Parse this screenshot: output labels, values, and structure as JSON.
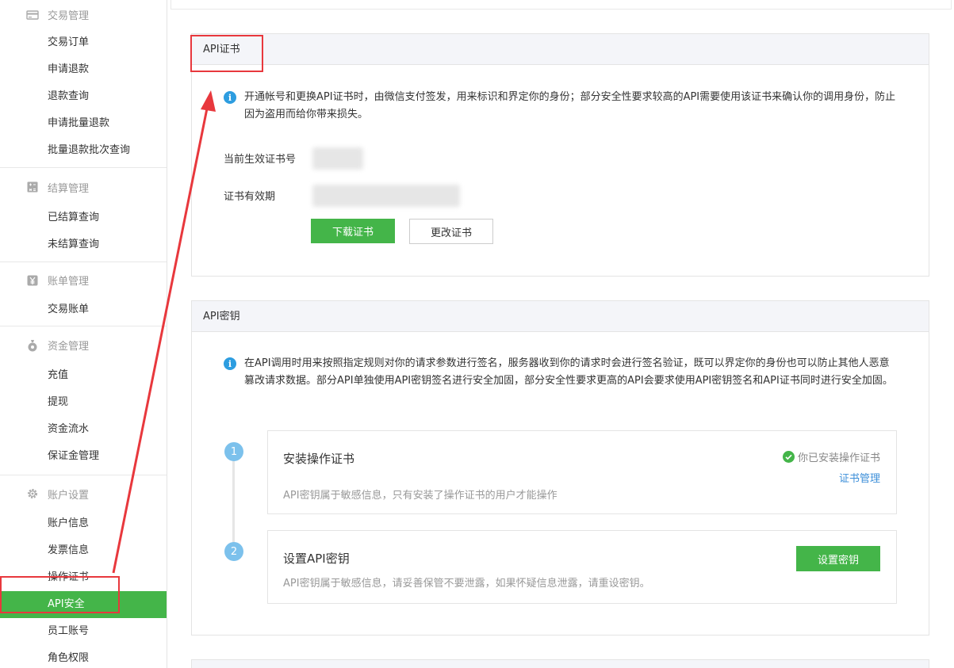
{
  "sidebar": {
    "groups": [
      {
        "title": "交易管理",
        "icon": "card-icon",
        "items": [
          "交易订单",
          "申请退款",
          "退款查询",
          "申请批量退款",
          "批量退款批次查询"
        ]
      },
      {
        "title": "结算管理",
        "icon": "calculator-icon",
        "items": [
          "已结算查询",
          "未结算查询"
        ]
      },
      {
        "title": "账单管理",
        "icon": "yen-icon",
        "items": [
          "交易账单"
        ]
      },
      {
        "title": "资金管理",
        "icon": "money-bag-icon",
        "items": [
          "充值",
          "提现",
          "资金流水",
          "保证金管理"
        ]
      },
      {
        "title": "账户设置",
        "icon": "gear-icon",
        "items": [
          "账户信息",
          "发票信息",
          "操作证书",
          "API安全",
          "员工账号",
          "角色权限"
        ]
      }
    ],
    "active_item": "API安全"
  },
  "cert_panel": {
    "title": "API证书",
    "info": "开通帐号和更换API证书时，由微信支付签发，用来标识和界定你的身份；部分安全性要求较高的API需要使用该证书来确认你的调用身份，防止因为盗用而给你带来损失。",
    "current_cert_label": "当前生效证书号",
    "validity_label": "证书有效期",
    "download_button": "下载证书",
    "change_button": "更改证书"
  },
  "key_panel": {
    "title": "API密钥",
    "info": "在API调用时用来按照指定规则对你的请求参数进行签名，服务器收到你的请求时会进行签名验证，既可以界定你的身份也可以防止其他人恶意篡改请求数据。部分API单独使用API密钥签名进行安全加固，部分安全性要求更高的API会要求使用API密钥签名和API证书同时进行安全加固。",
    "steps": [
      {
        "num": "1",
        "title": "安装操作证书",
        "desc": "API密钥属于敏感信息，只有安装了操作证书的用户才能操作",
        "status": "你已安装操作证书",
        "link": "证书管理"
      },
      {
        "num": "2",
        "title": "设置API密钥",
        "desc": "API密钥属于敏感信息，请妥善保管不要泄露，如果怀疑信息泄露，请重设密钥。",
        "button": "设置密钥"
      }
    ]
  },
  "colors": {
    "accent_green": "#44b549",
    "info_blue": "#2d9de0",
    "annotation_red": "#e8383d",
    "step_blue": "#7cc1ec"
  }
}
